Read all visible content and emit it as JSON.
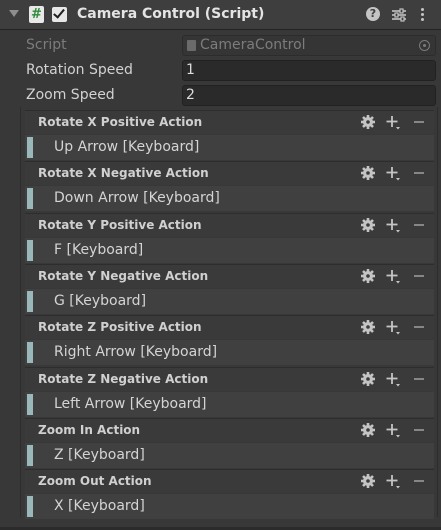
{
  "component": {
    "title": "Camera Control (Script)",
    "enabled": true
  },
  "fields": {
    "script": {
      "label": "Script",
      "value": "CameraControl"
    },
    "rotation_speed": {
      "label": "Rotation Speed",
      "value": "1"
    },
    "zoom_speed": {
      "label": "Zoom Speed",
      "value": "2"
    }
  },
  "actions": [
    {
      "name": "Rotate X Positive Action",
      "binding": "Up Arrow [Keyboard]"
    },
    {
      "name": "Rotate X Negative Action",
      "binding": "Down Arrow [Keyboard]"
    },
    {
      "name": "Rotate Y Positive Action",
      "binding": "F [Keyboard]"
    },
    {
      "name": "Rotate Y Negative Action",
      "binding": "G [Keyboard]"
    },
    {
      "name": "Rotate Z Positive Action",
      "binding": "Right Arrow [Keyboard]"
    },
    {
      "name": "Rotate Z Negative Action",
      "binding": "Left Arrow [Keyboard]"
    },
    {
      "name": "Zoom In Action",
      "binding": "Z [Keyboard]"
    },
    {
      "name": "Zoom Out Action",
      "binding": "X [Keyboard]"
    }
  ],
  "colors": {
    "background": "#383838",
    "binding_marker": "#9ab7b9",
    "script_icon_hash": "#2e8b3a"
  }
}
